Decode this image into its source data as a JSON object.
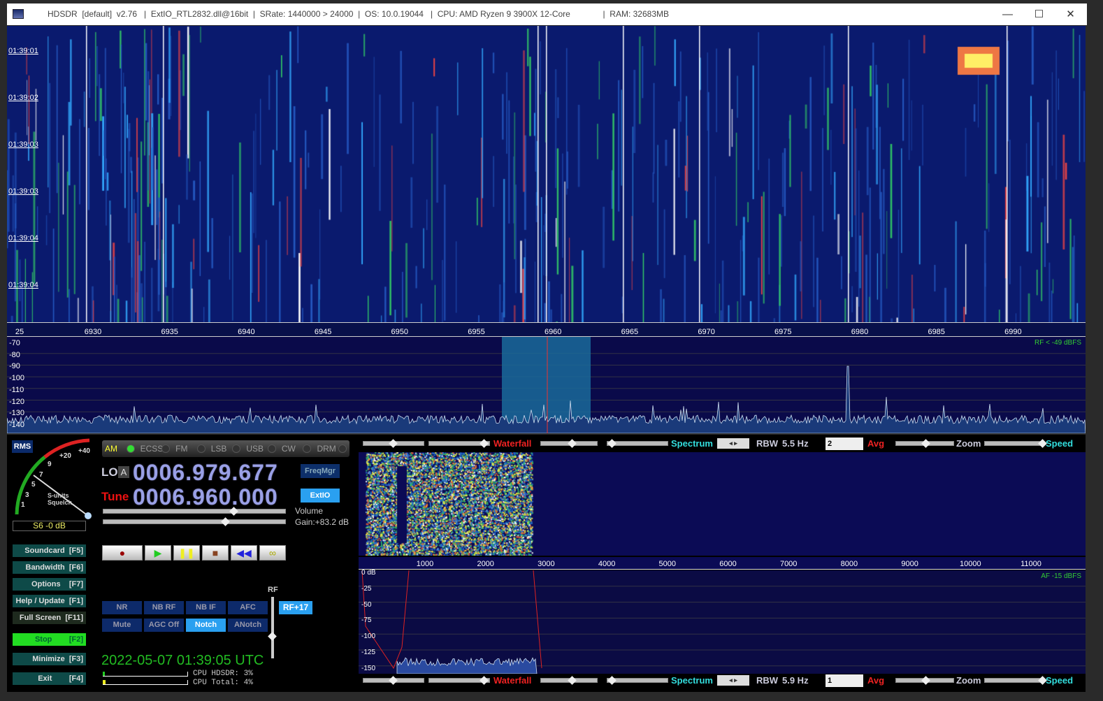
{
  "window": {
    "title": "HDSDR  [default]  v2.76   |  ExtIO_RTL2832.dll@16bit  |  SRate: 1440000 > 24000  |  OS: 10.0.19044   |  CPU: AMD Ryzen 9 3900X 12-Core              |  RAM: 32683MB",
    "minimize": "—",
    "maximize": "☐",
    "close": "✕"
  },
  "waterfall": {
    "times": [
      "01:39:01",
      "01:39:02",
      "01:39:03",
      "01:39:03",
      "01:39:04",
      "01:39:04"
    ]
  },
  "freq_axis": {
    "labels": [
      "25",
      "6930",
      "6935",
      "6940",
      "6945",
      "6950",
      "6955",
      "6960",
      "6965",
      "6970",
      "6975",
      "6980",
      "6985",
      "6990"
    ]
  },
  "spectrum": {
    "db_labels": [
      "-70",
      "-80",
      "-90",
      "-100",
      "-110",
      "-120",
      "-130",
      "-140"
    ],
    "level": "RF < -49 dBFS"
  },
  "smeter": {
    "mode": "RMS",
    "scale": [
      "1",
      "3",
      "5",
      "7",
      "9",
      "+20",
      "+40"
    ],
    "label1": "S-units",
    "label2": "Squelch",
    "reading": "S6 -0 dB"
  },
  "modes": [
    {
      "label": "AM",
      "active": true
    },
    {
      "label": "ECSS"
    },
    {
      "label": "FM"
    },
    {
      "label": "LSB"
    },
    {
      "label": "USB"
    },
    {
      "label": "CW"
    },
    {
      "label": "DRM"
    }
  ],
  "lo": {
    "label": "LO",
    "vfo": "A",
    "value": "0006.979.677"
  },
  "tune": {
    "label": "Tune",
    "value": "0006.960.000"
  },
  "buttons": {
    "freqmgr": "FreqMgr",
    "extio": "ExtIO",
    "rf": "RF+17",
    "rf_label": "RF"
  },
  "volume": {
    "label": "Volume",
    "gain": "Gain:+83.2 dB"
  },
  "side": [
    "Soundcard  [F5]",
    "Bandwidth  [F6]",
    "Options    [F7]",
    "Help / Update  [F1]",
    "Full Screen  [F11]",
    "Stop        [F2]",
    "Minimize  [F3]",
    "Exit        [F4]"
  ],
  "dsp": [
    [
      "NR",
      "NB RF",
      "NB IF",
      "AFC"
    ],
    [
      "Mute",
      "AGC Off",
      "Notch",
      "ANotch"
    ]
  ],
  "clock": "2022-05-07  01:39:05 UTC",
  "cpu": {
    "hdsdr": "CPU HDSDR: 3%",
    "total": "CPU Total: 4%"
  },
  "rf_controls": {
    "waterfall": "Waterfall",
    "spectrum": "Spectrum",
    "rbw_label": "RBW",
    "rbw": "5.5 Hz",
    "avg_value": "2",
    "avg": "Avg",
    "zoom": "Zoom",
    "speed": "Speed"
  },
  "af_controls": {
    "waterfall": "Waterfall",
    "spectrum": "Spectrum",
    "rbw_label": "RBW",
    "rbw": "5.9 Hz",
    "avg_value": "1",
    "avg": "Avg",
    "zoom": "Zoom",
    "speed": "Speed"
  },
  "af_axis": {
    "labels": [
      "1000",
      "2000",
      "3000",
      "4000",
      "5000",
      "6000",
      "7000",
      "8000",
      "9000",
      "10000",
      "11000"
    ]
  },
  "af_spectrum": {
    "db_labels": [
      "0 dB",
      "-25",
      "-50",
      "-75",
      "-100",
      "-125",
      "-150"
    ],
    "level": "AF -15 dBFS"
  },
  "colors": {
    "waterfall_bg": "#0a1a6e",
    "accent": "#2aa0f0",
    "stop": "#22dd22",
    "clock": "#22bb22"
  }
}
